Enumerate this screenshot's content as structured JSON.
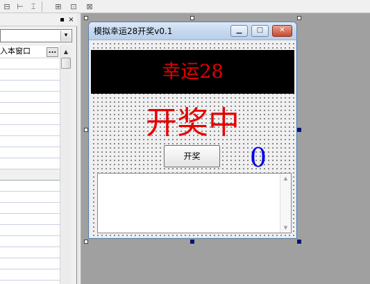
{
  "toolbar": {
    "items": [
      {
        "name": "align-left-icon",
        "glyph": "⊟"
      },
      {
        "name": "align-center-icon",
        "glyph": "⊢"
      },
      {
        "name": "align-distribute-icon",
        "glyph": "⌶"
      },
      {
        "name": "same-width-icon",
        "glyph": "⊞"
      },
      {
        "name": "same-height-icon",
        "glyph": "⊡"
      },
      {
        "name": "same-size-icon",
        "glyph": "⊠"
      }
    ]
  },
  "properties_panel": {
    "pin_glyph": "▪",
    "close_glyph": "×",
    "combo_arrow_glyph": "▾",
    "ellipsis_label": "...",
    "grid_header_value": "入本窗口",
    "scroll_up_glyph": "▲"
  },
  "form": {
    "title": "模拟幸运28开奖v0.1",
    "minimize_glyph": "▁",
    "maximize_glyph": "□",
    "close_glyph": "✕",
    "banner_text": "幸运28",
    "status_text": "开奖中",
    "draw_button_label": "开奖",
    "count_value": "0",
    "textarea_value": "",
    "textarea_scroll_up": "▲",
    "textarea_scroll_down": "▼"
  },
  "colors": {
    "banner_bg": "#000000",
    "banner_text": "#e60000",
    "status_text": "#e60000",
    "count_text": "#0000ee",
    "designer_bg": "#a0a0a0"
  }
}
